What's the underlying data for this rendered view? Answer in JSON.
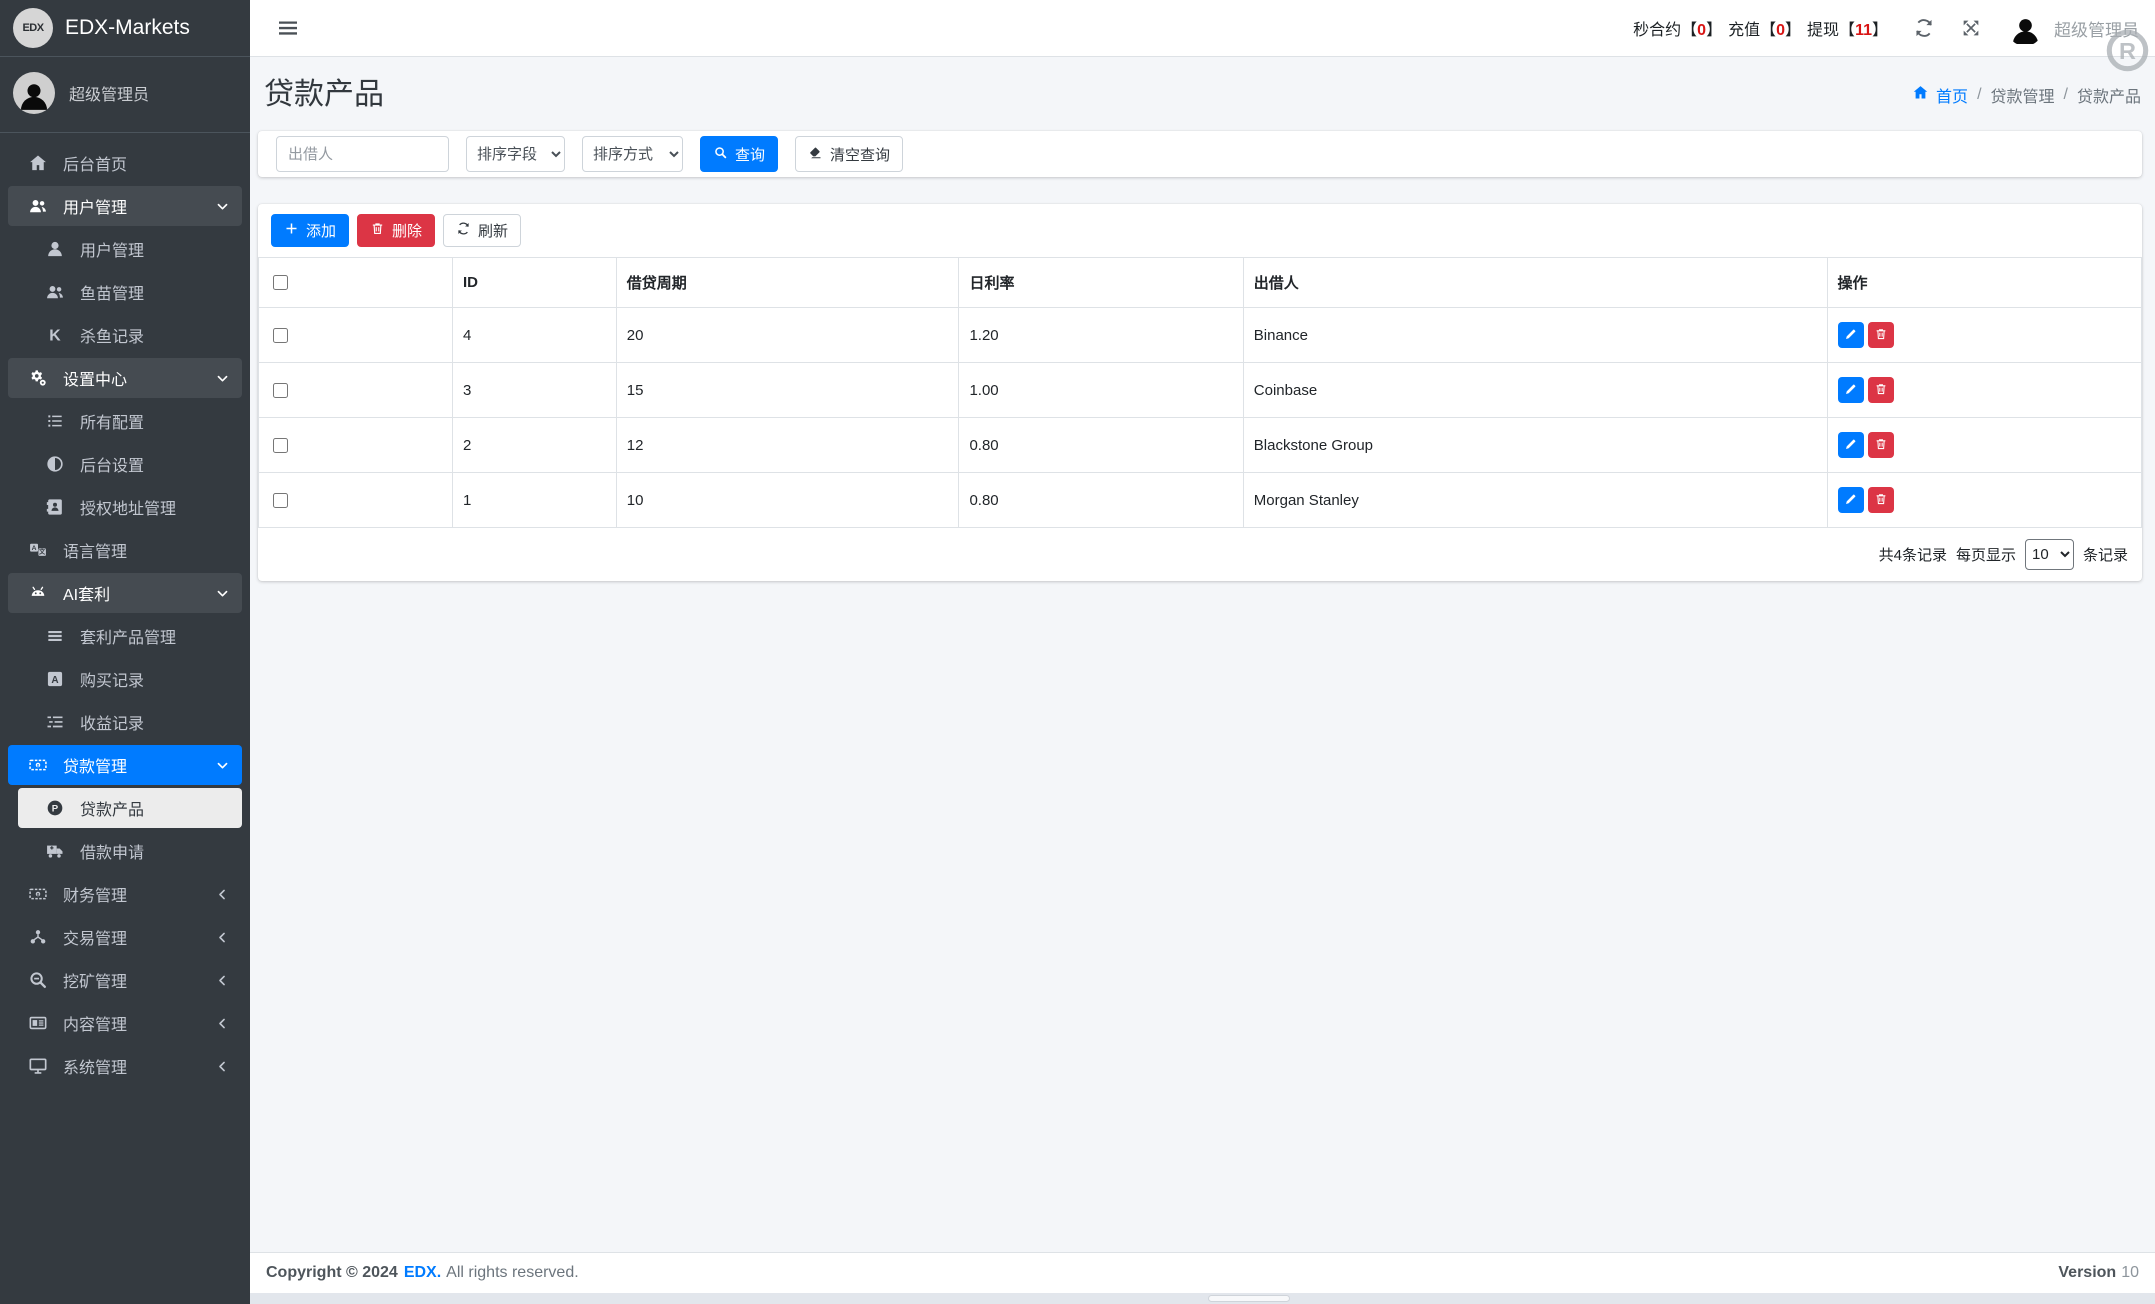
{
  "colors": {
    "primary": "#007bff",
    "danger": "#dc3545",
    "stat_number": "#d81414",
    "sidebar_bg": "#343a40",
    "sidebar_open_bg": "#454b51",
    "sidebar_text": "#c2c7d0",
    "active_item_bg": "#ececec",
    "content_bg": "#f4f6f9",
    "border": "#dee2e6",
    "muted": "#6c757d"
  },
  "brand": {
    "logo_text": "EDX",
    "name": "EDX-Markets"
  },
  "sidebar": {
    "user_name": "超级管理员",
    "user_icon": "avatar-icon",
    "menu": [
      {
        "key": "backend-home",
        "label": "后台首页",
        "icon": "home-icon",
        "state": "link"
      },
      {
        "key": "user-management",
        "label": "用户管理",
        "icon": "users-icon",
        "state": "open",
        "children": [
          {
            "key": "user-admin",
            "label": "用户管理",
            "icon": "user-icon"
          },
          {
            "key": "fry-management",
            "label": "鱼苗管理",
            "icon": "users-icon"
          },
          {
            "key": "kill-fish-records",
            "label": "杀鱼记录",
            "icon": "k-icon"
          }
        ]
      },
      {
        "key": "settings-center",
        "label": "设置中心",
        "icon": "cogs-icon",
        "state": "open",
        "children": [
          {
            "key": "all-configs",
            "label": "所有配置",
            "icon": "list-icon"
          },
          {
            "key": "backend-settings",
            "label": "后台设置",
            "icon": "adjust-icon"
          },
          {
            "key": "authorized-address-management",
            "label": "授权地址管理",
            "icon": "address-book-icon"
          }
        ]
      },
      {
        "key": "language-management",
        "label": "语言管理",
        "icon": "language-icon",
        "state": "link"
      },
      {
        "key": "ai-arbitrage",
        "label": "AI套利",
        "icon": "robot-icon",
        "state": "open",
        "children": [
          {
            "key": "arbitrage-product-management",
            "label": "套利产品管理",
            "icon": "bars3-icon"
          },
          {
            "key": "purchase-records",
            "label": "购买记录",
            "icon": "square-a-icon"
          },
          {
            "key": "earnings-records",
            "label": "收益记录",
            "icon": "tasks-icon"
          }
        ]
      },
      {
        "key": "loan-management",
        "label": "贷款管理",
        "icon": "money-icon",
        "state": "active-open",
        "children": [
          {
            "key": "loan-products",
            "label": "贷款产品",
            "icon": "p-circle-icon",
            "active": true
          },
          {
            "key": "loan-applications",
            "label": "借款申请",
            "icon": "truck-icon"
          }
        ]
      },
      {
        "key": "finance-management",
        "label": "财务管理",
        "icon": "money-icon",
        "state": "collapsed"
      },
      {
        "key": "trade-management",
        "label": "交易管理",
        "icon": "network-icon",
        "state": "collapsed"
      },
      {
        "key": "mining-management",
        "label": "挖矿管理",
        "icon": "search-minus-icon",
        "state": "collapsed"
      },
      {
        "key": "content-management",
        "label": "内容管理",
        "icon": "newspaper-icon",
        "state": "collapsed"
      },
      {
        "key": "system-management",
        "label": "系统管理",
        "icon": "desktop-icon",
        "state": "collapsed"
      }
    ]
  },
  "navbar": {
    "hamburger_icon": "bars-icon",
    "stats": [
      {
        "label": "秒合约",
        "value": "0"
      },
      {
        "label": "充值",
        "value": "0"
      },
      {
        "label": "提现",
        "value": "11"
      }
    ],
    "bracket_open": "【",
    "bracket_close": "】",
    "refresh_icon": "refresh-icon",
    "expand_icon": "expand-icon",
    "avatar_icon": "avatar-icon",
    "user_name": "超级管理员",
    "watermark_icon": "r-circle-icon"
  },
  "page": {
    "title": "贷款产品",
    "breadcrumb": {
      "separator": "/",
      "items": [
        {
          "label": "首页",
          "icon": "home-icon",
          "link": true
        },
        {
          "label": "贷款管理",
          "link": true
        },
        {
          "label": "贷款产品",
          "link": false
        }
      ]
    }
  },
  "filters": {
    "lender_placeholder": "出借人",
    "sort_field_label": "排序字段",
    "sort_order_label": "排序方式",
    "search_label": "查询",
    "search_icon": "search-icon",
    "clear_label": "清空查询",
    "clear_icon": "eraser-icon"
  },
  "toolbar": {
    "add_label": "添加",
    "add_icon": "plus-icon",
    "delete_label": "删除",
    "delete_icon": "trash-icon",
    "refresh_label": "刷新",
    "refresh_icon": "refresh-icon"
  },
  "table": {
    "columns": [
      "ID",
      "借贷周期",
      "日利率",
      "出借人",
      "操作"
    ],
    "rows": [
      {
        "id": "4",
        "period": "20",
        "rate": "1.20",
        "lender": "Binance"
      },
      {
        "id": "3",
        "period": "15",
        "rate": "1.00",
        "lender": "Coinbase"
      },
      {
        "id": "2",
        "period": "12",
        "rate": "0.80",
        "lender": "Blackstone Group"
      },
      {
        "id": "1",
        "period": "10",
        "rate": "0.80",
        "lender": "Morgan Stanley"
      }
    ],
    "row_actions": [
      {
        "name": "edit",
        "icon": "pencil-icon"
      },
      {
        "name": "delete",
        "icon": "trash-icon"
      }
    ]
  },
  "pagination": {
    "total_text": "共4条记录",
    "per_page_prefix": "每页显示",
    "per_page_value": "10",
    "per_page_suffix": "条记录"
  },
  "footer": {
    "copyright_prefix": "Copyright © 2024",
    "brand": "EDX.",
    "copyright_suffix": "All rights reserved.",
    "version_label": "Version",
    "version_value": "10"
  }
}
